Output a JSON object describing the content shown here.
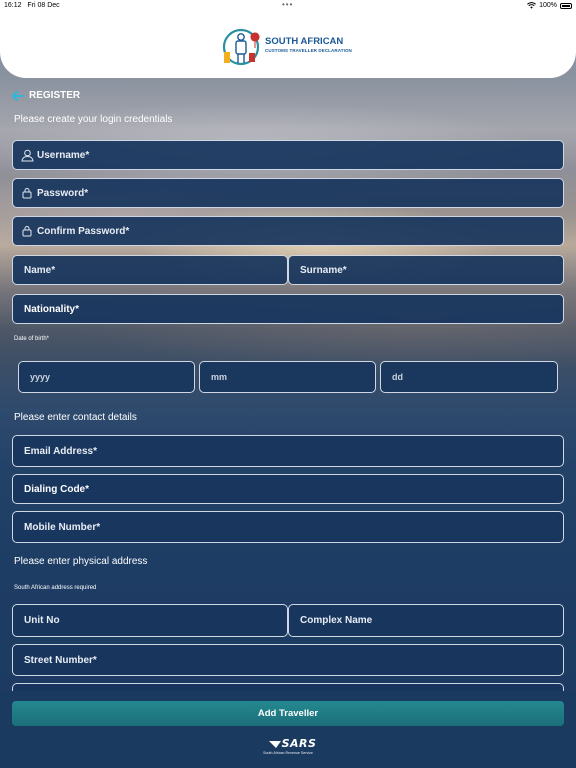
{
  "status_bar": {
    "time": "16:12",
    "date": "Fri 08 Dec",
    "battery": "100%"
  },
  "header": {
    "logo_title": "SOUTH AFRICAN",
    "logo_subtitle": "CUSTOMS TRAVELLER DECLARATION"
  },
  "nav": {
    "back_label": "REGISTER",
    "back_icon": "arrow-left-icon"
  },
  "credentials": {
    "intro": "Please create your login credentials",
    "username_placeholder": "Username*",
    "password_placeholder": "Password*",
    "confirm_password_placeholder": "Confirm Password*"
  },
  "personal": {
    "name_placeholder": "Name*",
    "surname_placeholder": "Surname*",
    "nationality_placeholder": "Nationality*",
    "dob_label": "Date of birth*",
    "dob_year": "yyyy",
    "dob_month": "mm",
    "dob_day": "dd"
  },
  "contact": {
    "intro": "Please enter contact details",
    "email_placeholder": "Email Address*",
    "dialing_code_placeholder": "Dialing Code*",
    "mobile_placeholder": "Mobile Number*"
  },
  "address": {
    "intro": "Please enter physical address",
    "note": "South African address required",
    "unit_placeholder": "Unit No",
    "complex_placeholder": "Complex Name",
    "street_number_placeholder": "Street Number*"
  },
  "actions": {
    "add_traveller_label": "Add Traveller"
  },
  "footer": {
    "brand": "SARS",
    "brand_tagline": "South African Revenue Service"
  },
  "colors": {
    "field_background": "#18355d",
    "accent_button": "#1f7e87",
    "back_arrow": "#2fb6d8",
    "logo_text": "#1a5a96"
  }
}
